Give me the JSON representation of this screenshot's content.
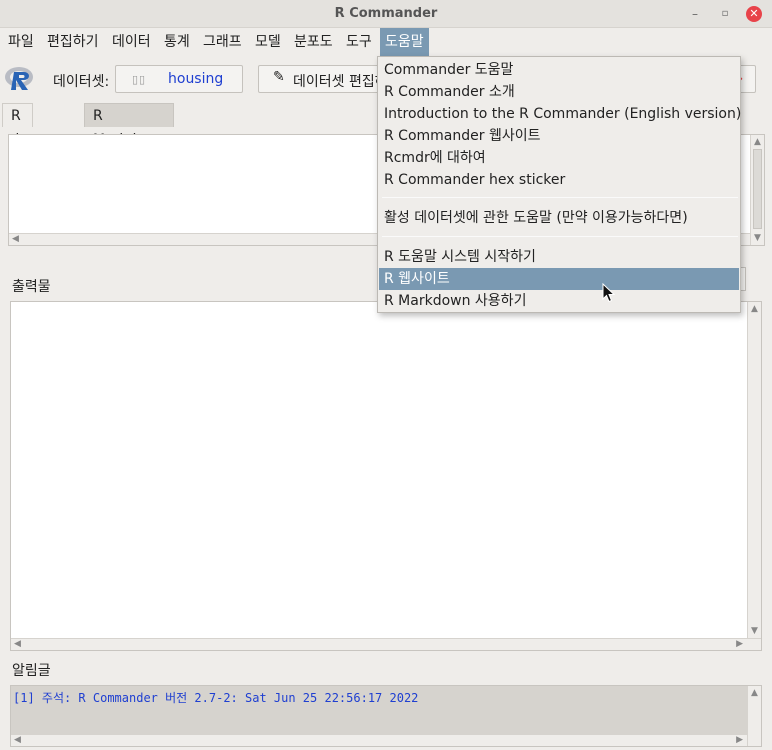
{
  "window": {
    "title": "R Commander",
    "minimize": "–",
    "maximize": "▫",
    "close": "✕"
  },
  "menubar": {
    "items": [
      "파일",
      "편집하기",
      "데이터",
      "통계",
      "그래프",
      "모델",
      "분포도",
      "도구",
      "도움말"
    ],
    "active_index": 8
  },
  "toolbar": {
    "dataset_label": "데이터셋:",
    "dataset_name": "housing",
    "edit_label": "데이터셋 편집하기"
  },
  "tabs": [
    "R 스크립트",
    "R Markdown"
  ],
  "output": {
    "label": "출력물"
  },
  "messages": {
    "label": "알림글",
    "text": "[1] 주석: R Commander 버전 2.7-2: Sat Jun 25 22:56:17 2022"
  },
  "help_menu": {
    "group1": [
      "Commander 도움말",
      "R Commander 소개",
      "Introduction to the R Commander (English version)",
      "R Commander 웹사이트",
      "Rcmdr에 대하여",
      "R Commander hex sticker"
    ],
    "group2": [
      "활성 데이터셋에 관한 도움말 (만약 이용가능하다면)"
    ],
    "group3": [
      "R 도움말 시스템 시작하기",
      "R 웹사이트",
      "R Markdown 사용하기"
    ],
    "highlighted": "R 웹사이트"
  },
  "colors": {
    "highlight": "#7a99b2",
    "dataset_text": "#1f3fd1",
    "close_button": "#e8434a"
  }
}
